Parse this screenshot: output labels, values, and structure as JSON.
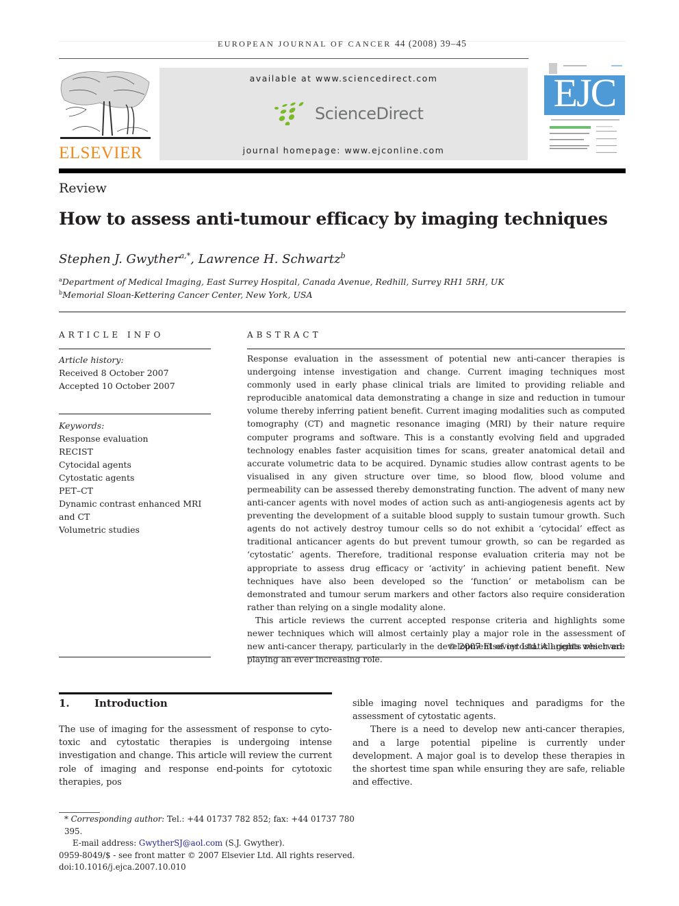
{
  "running_header": {
    "journal": "EUROPEAN JOURNAL OF CANCER",
    "volume_info": "44 (2008) 39–45"
  },
  "masthead": {
    "publisher_logo_text": "ELSEVIER",
    "available_at": "available at www.sciencedirect.com",
    "sciencedirect_logo": "ScienceDirect",
    "journal_homepage": "journal homepage: www.ejconline.com",
    "cover_logo": "EJC",
    "colors": {
      "elsevier_orange": "#f08a1c",
      "sciencedirect_green": "#7ab929",
      "ejc_blue": "#4e9ad6",
      "masthead_gray": "#e5e5e5"
    }
  },
  "article": {
    "type": "Review",
    "title": "How to assess anti-tumour efficacy by imaging techniques",
    "authors": [
      {
        "name": "Stephen J. Gwyther",
        "sup": "a,*"
      },
      {
        "name": "Lawrence H. Schwartz",
        "sup": "b"
      }
    ],
    "author_separator": ", ",
    "affiliations": [
      {
        "label": "a",
        "text": "Department of Medical Imaging, East Surrey Hospital, Canada Avenue, Redhill, Surrey RH1 5RH, UK"
      },
      {
        "label": "b",
        "text": "Memorial Sloan-Kettering Cancer Center, New York, USA"
      }
    ]
  },
  "article_info": {
    "heading": "ARTICLE INFO",
    "history_label": "Article history:",
    "received": "Received 8 October 2007",
    "accepted": "Accepted 10 October 2007",
    "keywords_label": "Keywords:",
    "keywords": [
      "Response evaluation",
      "RECIST",
      "Cytocidal agents",
      "Cytostatic agents",
      "PET–CT",
      "Dynamic contrast enhanced MRI",
      "and CT",
      "Volumetric studies"
    ]
  },
  "abstract": {
    "heading": "ABSTRACT",
    "paragraphs": [
      "Response evaluation in the assessment of potential new anti-cancer therapies is undergoing intense investigation and change. Current imaging techniques most commonly used in early phase clinical trials are limited to providing reliable and reproducible anatomical data dem­onstrating a change in size and reduction in tumour volume thereby inferring patient benefit. Current imaging modalities such as computed tomography (CT) and magnetic resonance imaging (MRI) by their nature require computer programs and software. This is a constantly evolving field and upgraded technology enables faster acquisition times for scans, greater anatomical detail and accurate volumetric data to be acquired. Dynamic studies allow con­trast agents to be visualised in any given structure over time, so blood flow, blood volume and permeability can be assessed thereby demonstrating function. The advent of many new anti-cancer agents with novel modes of action such as anti-angiogenesis agents act by preventing the development of a suitable blood supply to sustain tumour growth. Such agents do not actively destroy tumour cells so do not exhibit a ‘cytocidal’ effect as traditional anti­cancer agents do but prevent tumour growth, so can be regarded as ‘cytostatic’ agents. There­fore, traditional response evaluation criteria may not be appropriate to assess drug efficacy or ‘activity’ in achieving patient benefit. New techniques have also been developed so the ‘func­tion’ or metabolism can be demonstrated and tumour serum markers and other factors also require consideration rather than relying on a single modality alone.",
      "This article reviews the current accepted response criteria and highlights some newer tech­niques which will almost certainly play a major role in the assessment of new anti-cancer therapy, particularly in the development of cytostatic agents which are playing an ever increasing role."
    ],
    "copyright": "© 2007 Elsevier Ltd. All rights reserved."
  },
  "introduction": {
    "number": "1.",
    "heading": "Introduction",
    "col1_paragraph": "The use of imaging for the assessment of response to cyto­toxic and cytostatic therapies is undergoing intense investiga­tion and change. This article will review the current role of imaging and response end-points for cytotoxic therapies, pos­",
    "col2_paragraph_continued": "sible imaging novel techniques and paradigms for the assess­ment of cytostatic agents.",
    "col2_paragraph": "There is a need to develop new anti-cancer therapies, and a large potential pipeline is currently under development. A major goal is to develop these therapies in the shortest time span while ensuring they are safe, reliable and effective."
  },
  "footnotes": {
    "marker": "*",
    "corresponding_label": "Corresponding author:",
    "contact": "Tel.: +44 01737 782 852; fax: +44 01737 780 395.",
    "email_label": "E-mail address:",
    "email": "GwytherSJ@aol.com",
    "email_owner": "(S.J. Gwyther).",
    "issn_line": "0959-8049/$ - see front matter © 2007 Elsevier Ltd. All rights reserved.",
    "doi": "doi:10.1016/j.ejca.2007.10.010"
  }
}
